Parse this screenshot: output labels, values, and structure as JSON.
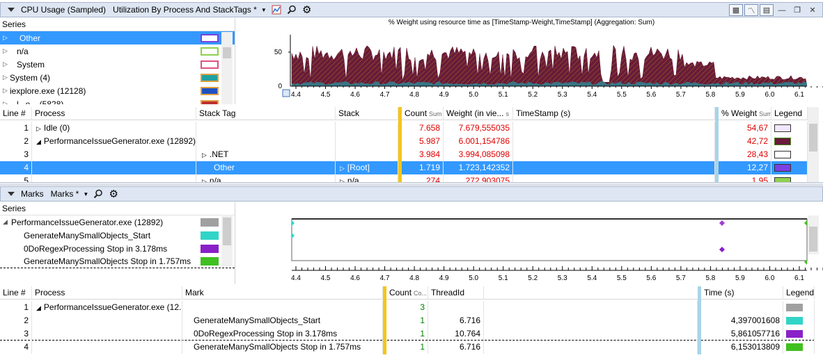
{
  "cpu_panel": {
    "title": "CPU Usage (Sampled)",
    "view_name": "Utilization By Process And StackTags *",
    "series_header": "Series",
    "series": [
      {
        "label": "Other",
        "color": "#7b3fe4",
        "selected": true
      },
      {
        "label": "n/a",
        "color": "#8fd14f",
        "selected": false
      },
      {
        "label": "System",
        "color": "#e05080",
        "selected": false
      },
      {
        "label": "System (4)",
        "color": "#20a0a0",
        "selected": false
      },
      {
        "label": "iexplore.exe (12128)",
        "color": "#2050c0",
        "selected": false
      },
      {
        "label": "l...e... (5828)",
        "color": "#c03030",
        "selected": false
      }
    ],
    "chart": {
      "title": "% Weight using resource time as [TimeStamp-Weight,TimeStamp] (Aggregation: Sum)",
      "y_ticks": [
        "50",
        "0"
      ],
      "x_ticks": [
        "4.4",
        "4.5",
        "4.6",
        "4.7",
        "4.8",
        "4.9",
        "5.0",
        "5.1",
        "5.2",
        "5.3",
        "5.4",
        "5.5",
        "5.6",
        "5.7",
        "5.8",
        "5.9",
        "6.0",
        "6.1"
      ]
    },
    "columns": [
      "Line #",
      "Process",
      "Stack Tag",
      "Stack",
      "Count",
      "Weight (in vie...",
      "TimeStamp (s)",
      "% Weight",
      "Legend"
    ],
    "count_sub": "Sum",
    "weight_sub": "s",
    "pct_sub": "Sum",
    "rows": [
      {
        "line": "1",
        "process": "Idle (0)",
        "tag": "",
        "stack": "",
        "count": "7.658",
        "weight": "7.679,555035",
        "pct": "54,67",
        "legend": "#f0e8ff",
        "tri": "right"
      },
      {
        "line": "2",
        "process": "PerformanceIssueGenerator.exe (12892)",
        "tag": "",
        "stack": "",
        "count": "5.987",
        "weight": "6.001,154786",
        "pct": "42,72",
        "legend": "#6a1a3a",
        "tri": "down"
      },
      {
        "line": "3",
        "process": "",
        "tag": ".NET",
        "stack": "",
        "count": "3.984",
        "weight": "3.994,085098",
        "pct": "28,43",
        "legend": "#ffffff",
        "tri": "none"
      },
      {
        "line": "4",
        "process": "",
        "tag": "Other",
        "stack": "[Root]",
        "count": "1.719",
        "weight": "1.723,142352",
        "pct": "12,27",
        "legend": "#7b3fe4",
        "tri": "none"
      },
      {
        "line": "5",
        "process": "",
        "tag": "n/a",
        "stack": "n/a",
        "count": "274",
        "weight": "272,903075",
        "pct": "1,95",
        "legend": "#8fd14f",
        "tri": "none"
      }
    ]
  },
  "marks_panel": {
    "title": "Marks",
    "view_name": "Marks *",
    "series_header": "Series",
    "series": [
      {
        "label": "PerformanceIssueGenerator.exe (12892)",
        "color": "#a0a0a0"
      },
      {
        "label": "GenerateManySmallObjects_Start",
        "color": "#30d5c8"
      },
      {
        "label": "0DoRegexProcessing Stop in 3.178ms",
        "color": "#8a20c8"
      },
      {
        "label": "GenerateManySmallObjects Stop in 1.757ms",
        "color": "#40c020"
      }
    ],
    "x_ticks": [
      "4.4",
      "4.5",
      "4.6",
      "4.7",
      "4.8",
      "4.9",
      "5.0",
      "5.1",
      "5.2",
      "5.3",
      "5.4",
      "5.5",
      "5.6",
      "5.7",
      "5.8",
      "5.9",
      "6.0",
      "6.1"
    ],
    "columns": [
      "Line #",
      "Process",
      "Mark",
      "Count",
      "ThreadId",
      "Time (s)",
      "Legend"
    ],
    "count_sub": "Co...",
    "rows": [
      {
        "line": "1",
        "process": "PerformanceIssueGenerator.exe (12...",
        "mark": "",
        "count": "3",
        "thread": "",
        "time": "",
        "legend": "#a0a0a0"
      },
      {
        "line": "2",
        "process": "",
        "mark": "GenerateManySmallObjects_Start",
        "count": "1",
        "thread": "6.716",
        "time": "4,397001608",
        "legend": "#30d5c8"
      },
      {
        "line": "3",
        "process": "",
        "mark": "0DoRegexProcessing Stop in 3.178ms",
        "count": "1",
        "thread": "10.764",
        "time": "5,861057716",
        "legend": "#8a20c8"
      },
      {
        "line": "4",
        "process": "",
        "mark": "GenerateManySmallObjects Stop in 1.757ms",
        "count": "1",
        "thread": "6.716",
        "time": "6,153013809",
        "legend": "#40c020"
      }
    ]
  }
}
